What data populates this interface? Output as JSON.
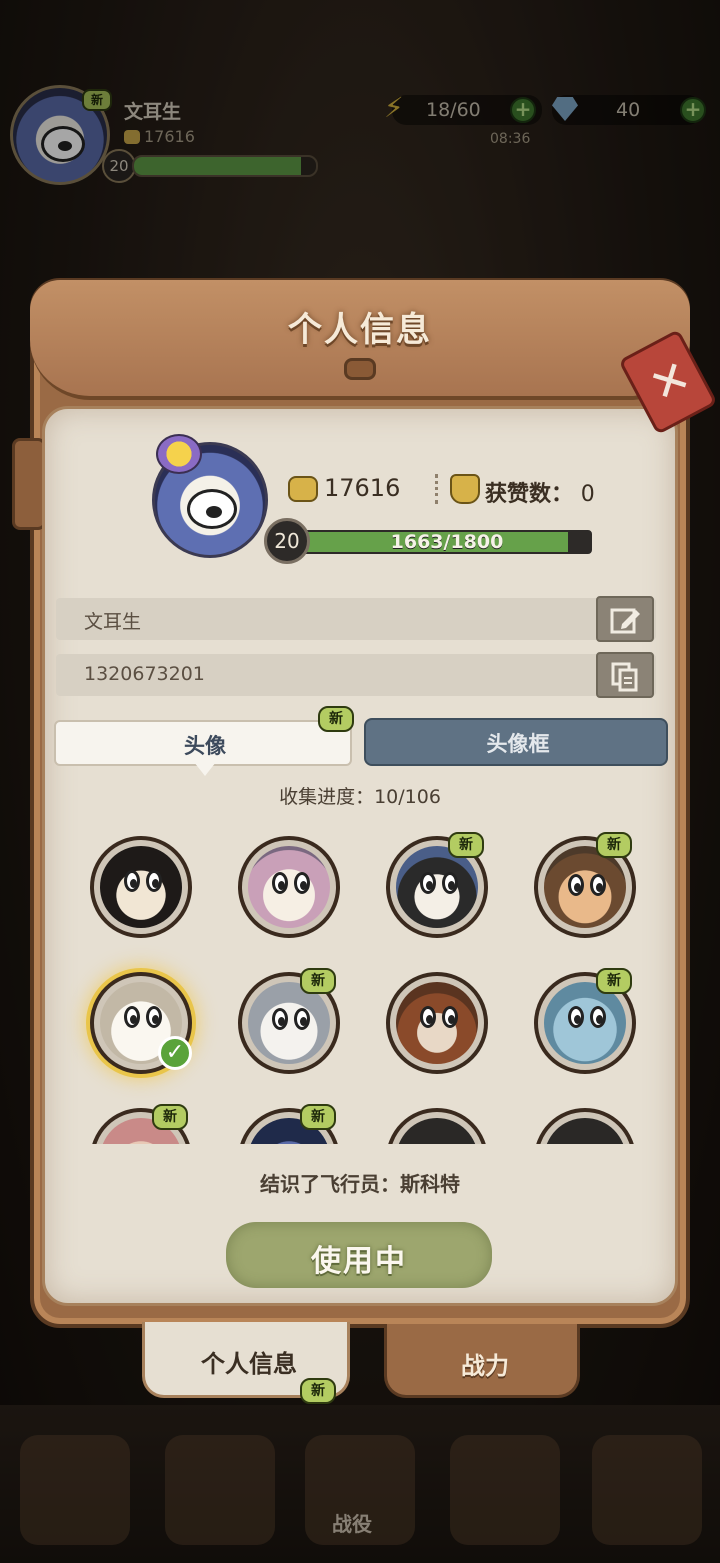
{
  "hud": {
    "new_badge": "新",
    "player_name": "文耳生",
    "power": "17616",
    "level": "20",
    "xp_fraction": 0.92,
    "stamina": "18/60",
    "timer": "08:36",
    "gems": "40"
  },
  "panel": {
    "title": "个人信息",
    "close_label": "✕"
  },
  "profile": {
    "power": "17616",
    "likes_label": "获赞数：",
    "likes_value": "0",
    "level": "20",
    "xp_text": "1663/1800",
    "xp_fraction": 0.924,
    "name": "文耳生",
    "id": "1320673201"
  },
  "tabs": {
    "avatar_label": "头像",
    "frame_label": "头像框",
    "new_badge": "新"
  },
  "collection": {
    "progress_label": "收集进度：",
    "progress_value": "10/106"
  },
  "avatars": [
    {
      "name": "avatar-1",
      "new": false,
      "selected": false
    },
    {
      "name": "avatar-2",
      "new": false,
      "selected": false
    },
    {
      "name": "avatar-3",
      "new": true,
      "selected": false
    },
    {
      "name": "avatar-4",
      "new": true,
      "selected": false
    },
    {
      "name": "avatar-5",
      "new": false,
      "selected": true
    },
    {
      "name": "avatar-6",
      "new": true,
      "selected": false
    },
    {
      "name": "avatar-7",
      "new": false,
      "selected": false
    },
    {
      "name": "avatar-8",
      "new": true,
      "selected": false
    },
    {
      "name": "avatar-9",
      "new": true,
      "selected": false
    },
    {
      "name": "avatar-10",
      "new": true,
      "selected": false
    },
    {
      "name": "avatar-11",
      "new": false,
      "selected": false
    },
    {
      "name": "avatar-12",
      "new": false,
      "selected": false
    }
  ],
  "selected_info": {
    "text": "结识了飞行员：斯科特"
  },
  "use_button": {
    "label": "使用中"
  },
  "panel_tabs": {
    "info_label": "个人信息",
    "power_label": "战力",
    "new_badge": "新"
  },
  "bottom_nav": {
    "campaign_label": "战役"
  },
  "colors": {
    "panel_wood": "#9a6a45",
    "paper": "#e6dfd2",
    "xp_green": "#66a14a",
    "close_red": "#b8463a",
    "frame_tab": "#5f7284",
    "use_button": "#9da66e"
  }
}
